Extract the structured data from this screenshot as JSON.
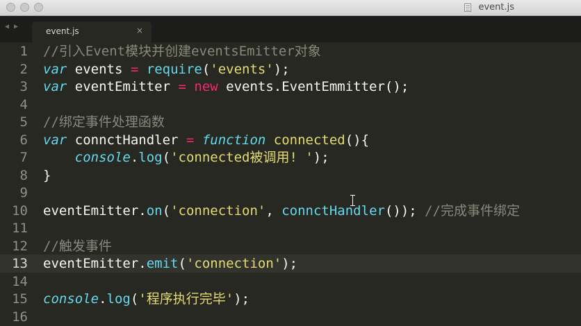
{
  "window": {
    "title": "event.js"
  },
  "tabs": [
    {
      "label": "event.js",
      "close": "×"
    }
  ],
  "nav": {
    "back": "◀",
    "forward": "▶"
  },
  "editor": {
    "active_line": 13,
    "lines": [
      {
        "n": "1",
        "tokens": [
          {
            "t": "//引入Event模块并创建eventsEmitter对象",
            "c": "cm"
          }
        ]
      },
      {
        "n": "2",
        "tokens": [
          {
            "t": "var",
            "c": "kw"
          },
          {
            "t": " events ",
            "c": "pl"
          },
          {
            "t": "=",
            "c": "op"
          },
          {
            "t": " ",
            "c": "pl"
          },
          {
            "t": "require",
            "c": "fn"
          },
          {
            "t": "(",
            "c": "pl"
          },
          {
            "t": "'events'",
            "c": "str"
          },
          {
            "t": ");",
            "c": "pl"
          }
        ]
      },
      {
        "n": "3",
        "tokens": [
          {
            "t": "var",
            "c": "kw"
          },
          {
            "t": " eventEmitter ",
            "c": "pl"
          },
          {
            "t": "=",
            "c": "op"
          },
          {
            "t": " ",
            "c": "pl"
          },
          {
            "t": "new",
            "c": "op"
          },
          {
            "t": " events.EventEmmitter();",
            "c": "pl"
          }
        ]
      },
      {
        "n": "4",
        "tokens": []
      },
      {
        "n": "5",
        "tokens": [
          {
            "t": "//绑定事件处理函数",
            "c": "cm"
          }
        ]
      },
      {
        "n": "6",
        "tokens": [
          {
            "t": "var",
            "c": "kw"
          },
          {
            "t": " connctHandler ",
            "c": "pl"
          },
          {
            "t": "=",
            "c": "op"
          },
          {
            "t": " ",
            "c": "pl"
          },
          {
            "t": "function",
            "c": "kw"
          },
          {
            "t": " connected",
            "c": "str"
          },
          {
            "t": "(){",
            "c": "pl"
          }
        ]
      },
      {
        "n": "7",
        "tokens": [
          {
            "t": "    ",
            "c": "pl"
          },
          {
            "t": "console",
            "c": "kw"
          },
          {
            "t": ".",
            "c": "pl"
          },
          {
            "t": "log",
            "c": "fn"
          },
          {
            "t": "(",
            "c": "pl"
          },
          {
            "t": "'connected被调用! '",
            "c": "str"
          },
          {
            "t": ");",
            "c": "pl"
          }
        ]
      },
      {
        "n": "8",
        "tokens": [
          {
            "t": "}",
            "c": "pl"
          }
        ]
      },
      {
        "n": "9",
        "tokens": []
      },
      {
        "n": "10",
        "tokens": [
          {
            "t": "eventEmitter.",
            "c": "pl"
          },
          {
            "t": "on",
            "c": "fn"
          },
          {
            "t": "(",
            "c": "pl"
          },
          {
            "t": "'connection'",
            "c": "str"
          },
          {
            "t": ", ",
            "c": "pl"
          },
          {
            "t": "connctHandler",
            "c": "fn"
          },
          {
            "t": "()); ",
            "c": "pl"
          },
          {
            "t": "//完成事件绑定",
            "c": "cm"
          }
        ]
      },
      {
        "n": "11",
        "tokens": []
      },
      {
        "n": "12",
        "tokens": [
          {
            "t": "//触发事件",
            "c": "cm"
          }
        ]
      },
      {
        "n": "13",
        "tokens": [
          {
            "t": "eventEmitter.",
            "c": "pl"
          },
          {
            "t": "emit",
            "c": "fn"
          },
          {
            "t": "(",
            "c": "pl"
          },
          {
            "t": "'connection'",
            "c": "str"
          },
          {
            "t": ");",
            "c": "pl"
          }
        ]
      },
      {
        "n": "14",
        "tokens": []
      },
      {
        "n": "15",
        "tokens": [
          {
            "t": "console",
            "c": "kw"
          },
          {
            "t": ".",
            "c": "pl"
          },
          {
            "t": "log",
            "c": "fn"
          },
          {
            "t": "(",
            "c": "pl"
          },
          {
            "t": "'程序执行完毕'",
            "c": "str"
          },
          {
            "t": ");",
            "c": "pl"
          }
        ]
      },
      {
        "n": "16",
        "tokens": []
      }
    ]
  }
}
